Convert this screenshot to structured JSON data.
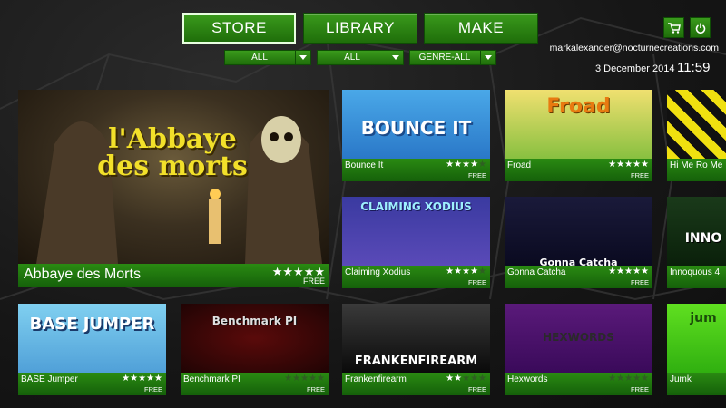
{
  "nav": {
    "store": "STORE",
    "library": "LIBRARY",
    "make": "MAKE"
  },
  "icons": {
    "cart": "cart-icon",
    "power": "power-icon"
  },
  "filters": {
    "first": "ALL",
    "second": "ALL",
    "genre": "GENRE-ALL"
  },
  "account": {
    "email": "markalexander@nocturnecreations.com",
    "date": "3 December 2014",
    "time": "11:59"
  },
  "colors": {
    "accent": "#2a8a12",
    "accent_dark": "#15600a",
    "star_on": "#ffffff",
    "star_off": "#2f5f22"
  },
  "featured": {
    "name": "Abbaye des Morts",
    "stars": 5,
    "price": "FREE",
    "art_text": "l'Abbaye des morts"
  },
  "games": [
    {
      "name": "Bounce It",
      "stars": 4,
      "price": "FREE",
      "art_text": "BOUNCE IT"
    },
    {
      "name": "Froad",
      "stars": 5,
      "price": "FREE",
      "art_text": "Froad"
    },
    {
      "name": "Hi Me Ro Me",
      "stars": 0,
      "price": "",
      "art_text": ""
    },
    {
      "name": "Claiming Xodius",
      "stars": 4,
      "price": "FREE",
      "art_text": "CLAIMING XODIUS"
    },
    {
      "name": "Gonna Catcha",
      "stars": 5,
      "price": "FREE",
      "art_text": "Gonna Catcha"
    },
    {
      "name": "Innoquous 4",
      "stars": 0,
      "price": "",
      "art_text": "INNO"
    },
    {
      "name": "BASE Jumper",
      "stars": 5,
      "price": "FREE",
      "art_text": "BASE JUMPER"
    },
    {
      "name": "Benchmark PI",
      "stars": 0,
      "price": "FREE",
      "art_text": "Benchmark PI"
    },
    {
      "name": "Frankenfirearm",
      "stars": 2,
      "price": "FREE",
      "art_text": "FRANKENFIREARM"
    },
    {
      "name": "Hexwords",
      "stars": 0,
      "price": "FREE",
      "art_text": "HEXWORDS"
    },
    {
      "name": "Jumk",
      "stars": 0,
      "price": "",
      "art_text": "jum"
    }
  ]
}
